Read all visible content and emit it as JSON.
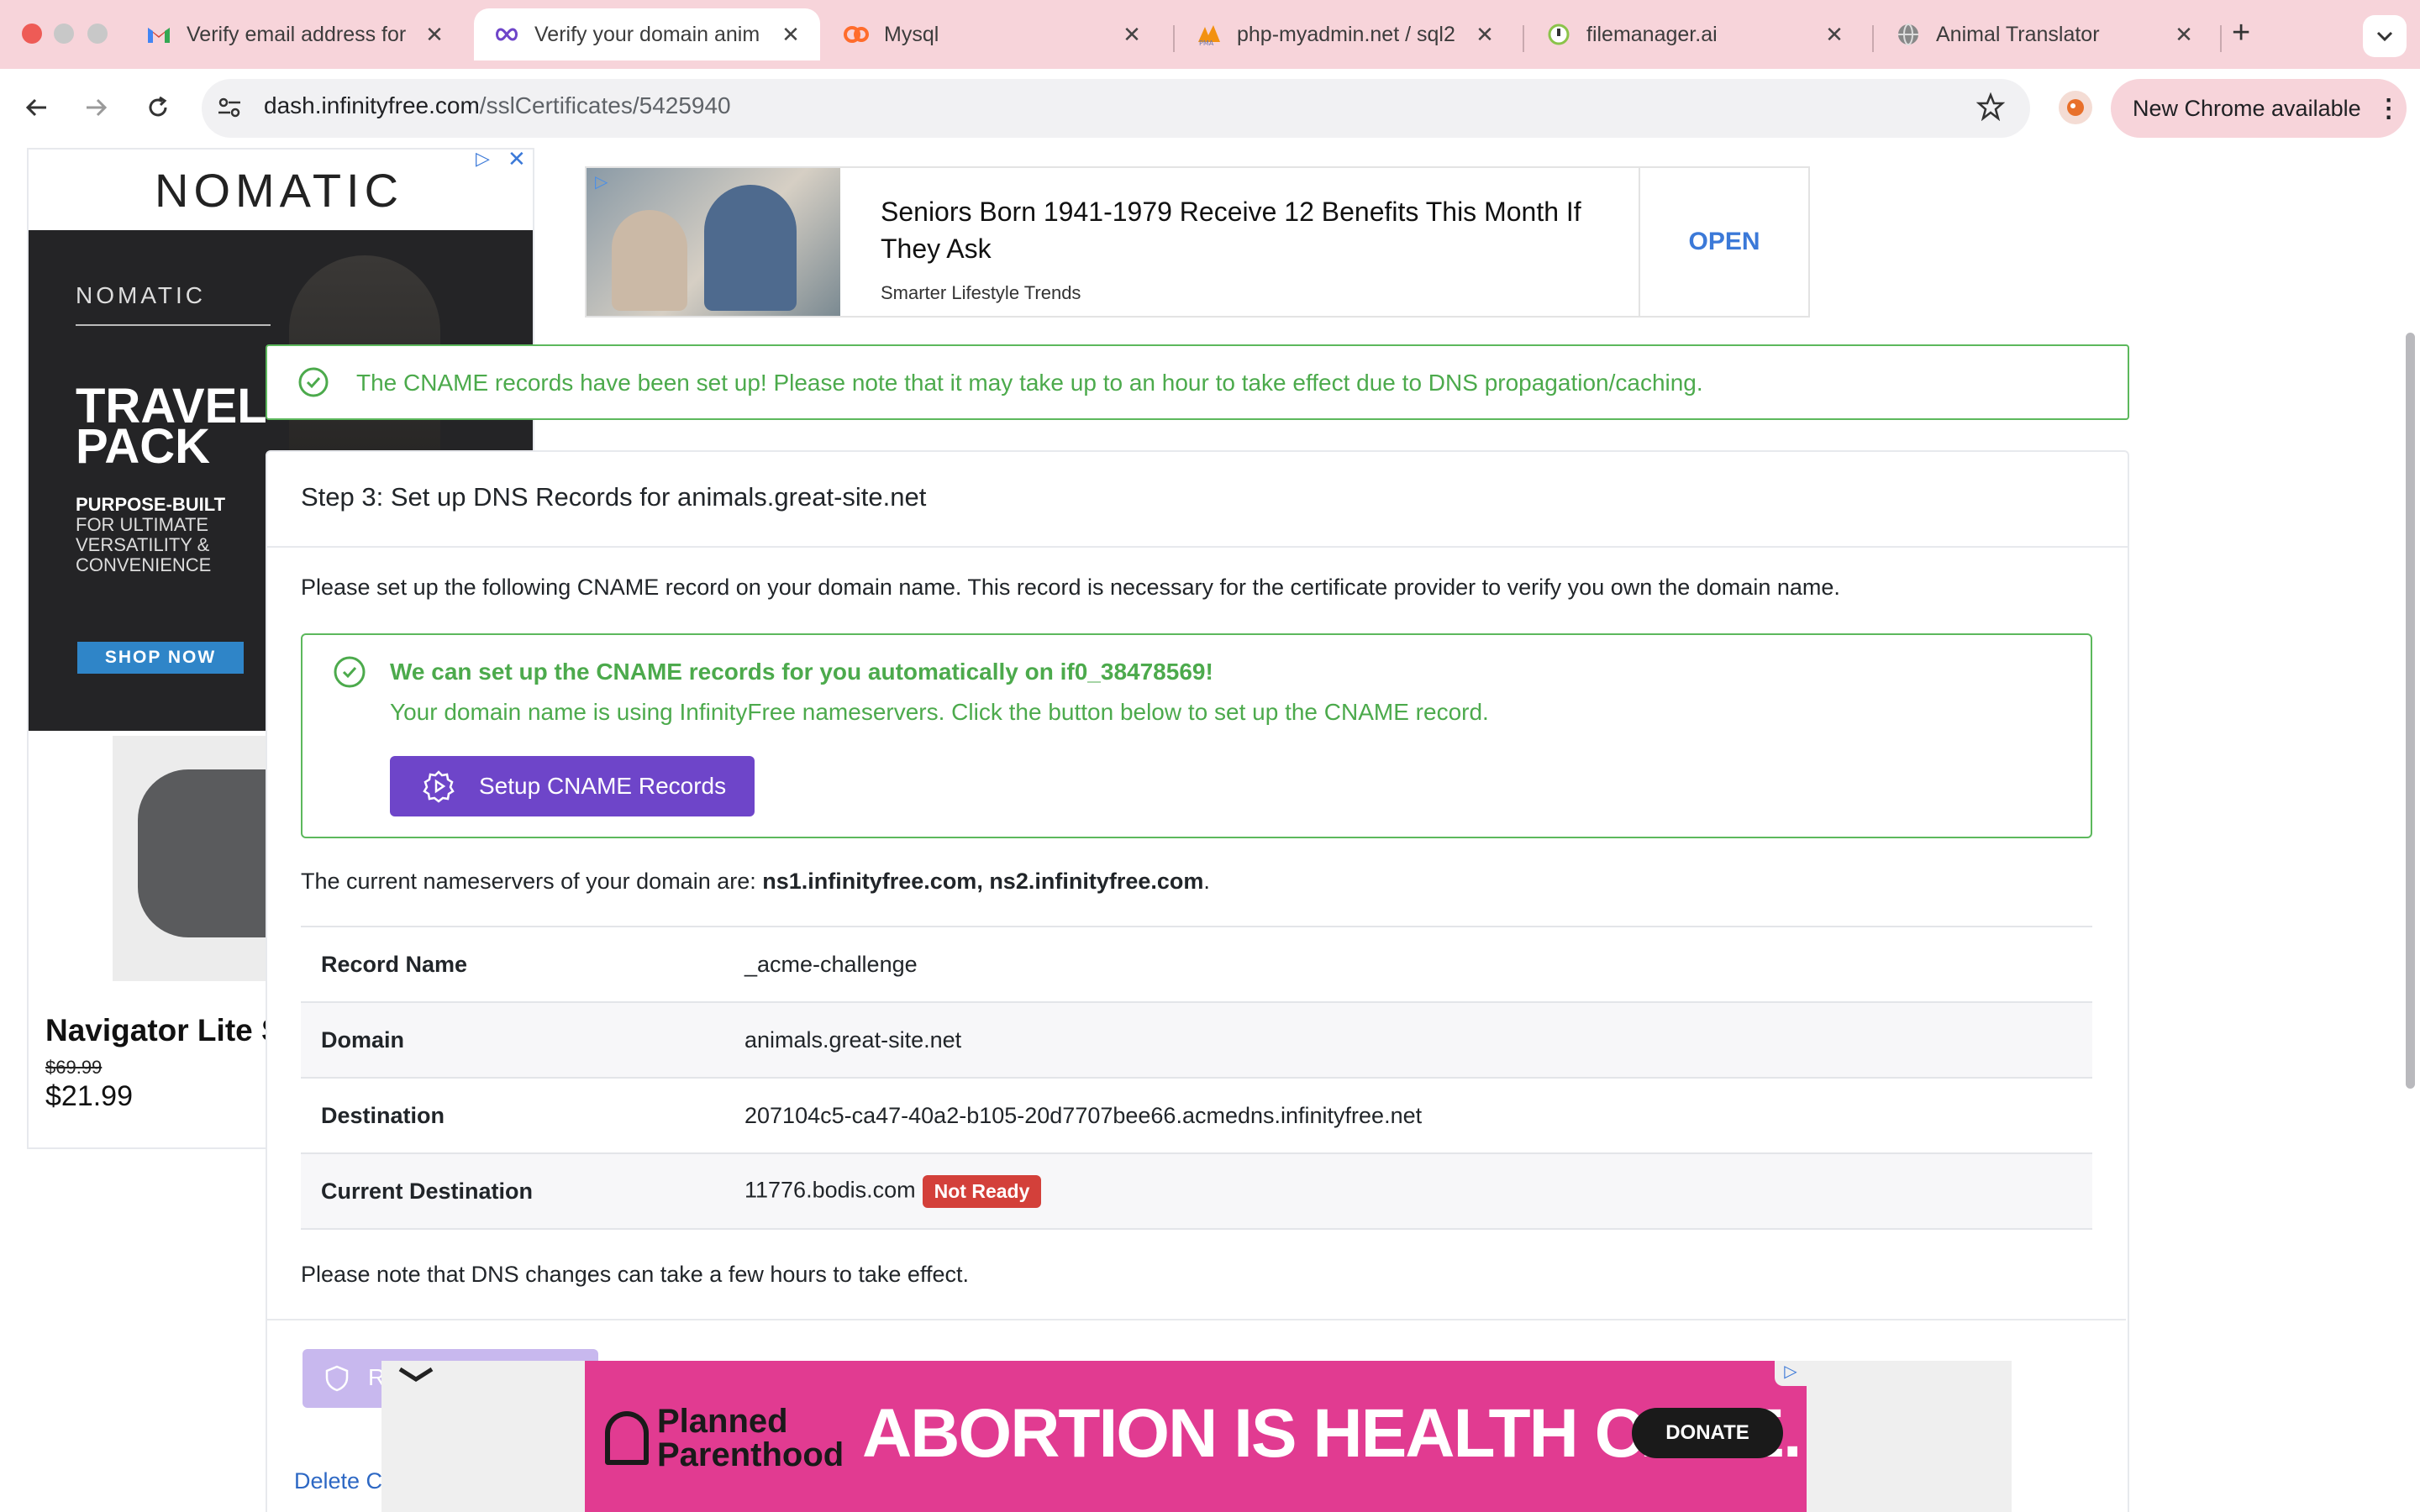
{
  "browser": {
    "tabs": [
      {
        "title": "Verify email address for",
        "icon": "gmail-icon"
      },
      {
        "title": "Verify your domain anim",
        "icon": "infinityfree-icon",
        "active": true
      },
      {
        "title": "Mysql",
        "icon": "cpanel-icon"
      },
      {
        "title": "php-myadmin.net / sql2",
        "icon": "phpmyadmin-icon"
      },
      {
        "title": "filemanager.ai",
        "icon": "filemanager-icon"
      },
      {
        "title": "Animal Translator",
        "icon": "globe-icon"
      }
    ],
    "url_host": "dash.infinityfree.com",
    "url_path": "/sslCertificates/5425940",
    "update_label": "New Chrome available"
  },
  "top_ad": {
    "title": "Seniors Born 1941-1979 Receive 12 Benefits This Month If They Ask",
    "source": "Smarter Lifestyle Trends",
    "cta": "OPEN"
  },
  "left_ad": {
    "brand": "NOMATIC",
    "brand_small": "NOMATIC",
    "headline": "TRAVEL PACK",
    "line1": "PURPOSE-BUILT",
    "line2": "FOR ULTIMATE",
    "line3": "VERSATILITY &",
    "line4": "CONVENIENCE",
    "cta": "SHOP NOW",
    "product_name": "Navigator Lite S",
    "old_price": "$69.99",
    "new_price": "$21.99"
  },
  "alert_success": "The CNAME records have been set up! Please note that it may take up to an hour to take effect due to DNS propagation/caching.",
  "step": {
    "title": "Step 3: Set up DNS Records for animals.great-site.net",
    "intro": "Please set up the following CNAME record on your domain name. This record is necessary for the certificate provider to verify you own the domain name.",
    "auto_title": "We can set up the CNAME records for you automatically on if0_38478569!",
    "auto_sub": "Your domain name is using InfinityFree nameservers. Click the button below to set up the CNAME record.",
    "setup_button": "Setup CNAME Records",
    "ns_prefix": "The current nameservers of your domain are: ",
    "ns_values": "ns1.infinityfree.com, ns2.infinityfree.com",
    "ns_suffix": ".",
    "records": [
      {
        "label": "Record Name",
        "value": "_acme-challenge"
      },
      {
        "label": "Domain",
        "value": "animals.great-site.net"
      },
      {
        "label": "Destination",
        "value": "207104c5-ca47-40a2-b105-20d7707bee66.acmedns.infinityfree.net"
      },
      {
        "label": "Current Destination",
        "value": "11776.bodis.com",
        "badge": "Not Ready"
      }
    ],
    "note": "Please note that DNS changes can take a few hours to take effect.",
    "faded_button_initial": "R",
    "delete_link": "Delete C"
  },
  "bottom_ad": {
    "logo": "Planned Parenthood",
    "slogan": "ABORTION IS HEALTH CARE.",
    "cta": "DONATE"
  },
  "colors": {
    "tabstrip": "#f7d4da",
    "success": "#5cb85c",
    "primary_button": "#6e45c9",
    "danger_badge": "#d3403a",
    "ad_pink": "#e13b91"
  }
}
